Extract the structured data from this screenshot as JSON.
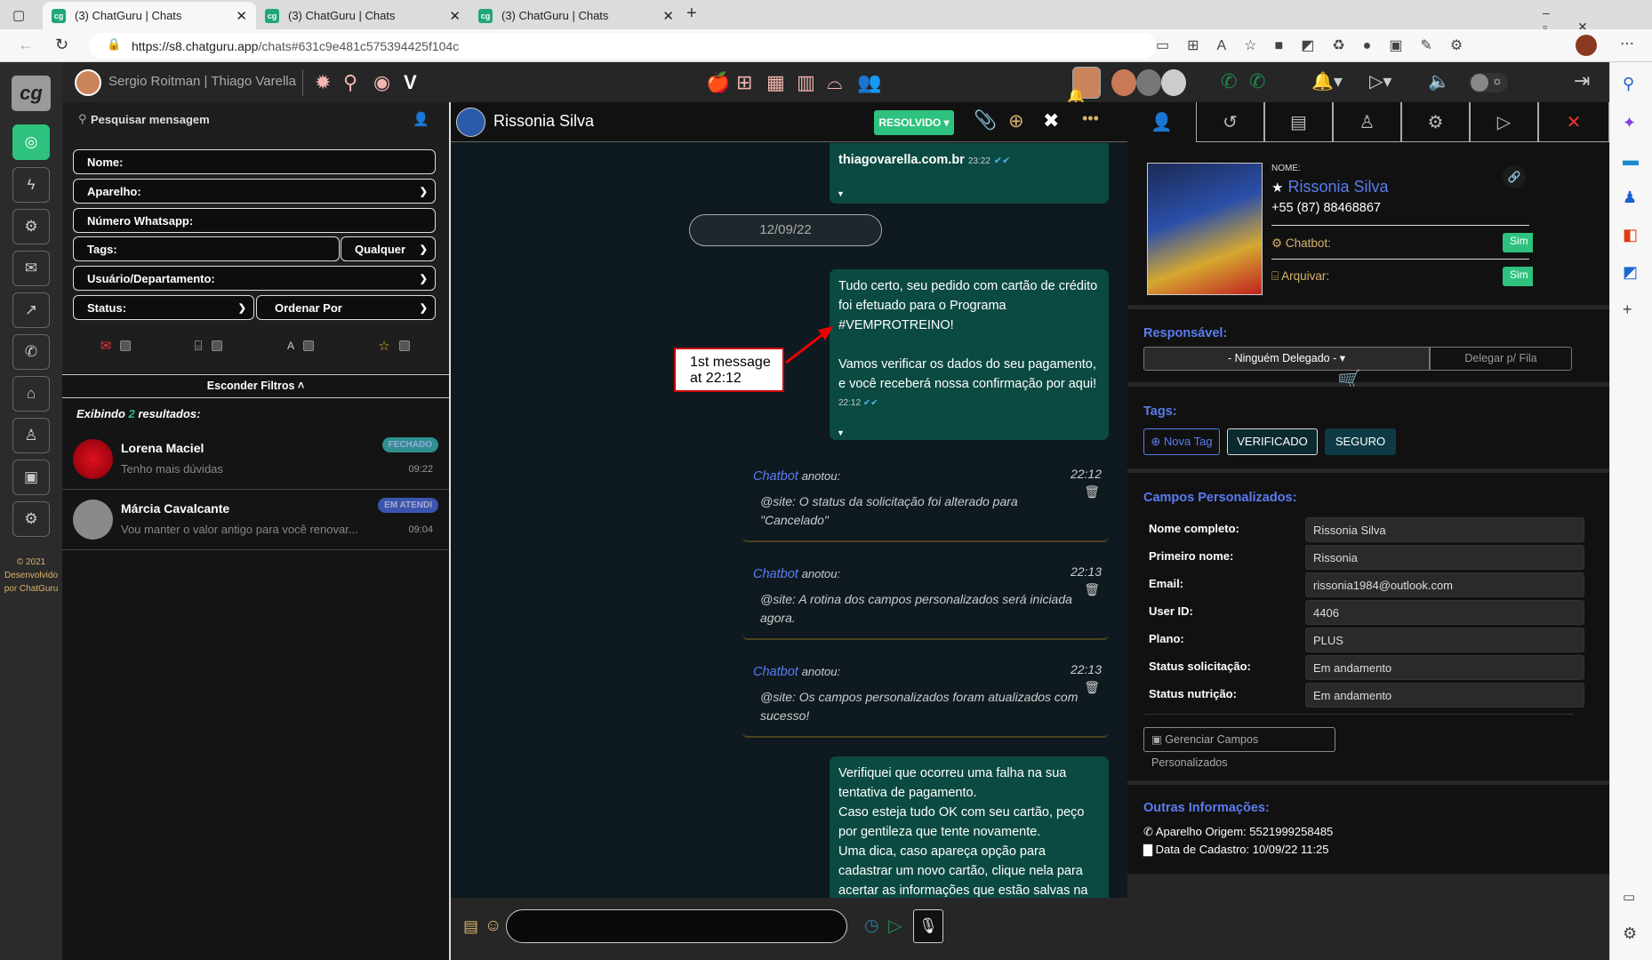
{
  "browser": {
    "tabs": [
      {
        "title": "(3) ChatGuru | Chats"
      },
      {
        "title": "(3) ChatGuru | Chats"
      },
      {
        "title": "(3) ChatGuru | Chats"
      }
    ],
    "url_host": "https://s8.chatguru.app",
    "url_path": "/chats#631c9e481c575394425f104c",
    "favicon": "cg"
  },
  "app": {
    "logo": "cg",
    "user": "Sergio Roitman | Thiago Varella",
    "footer": "© 2021 Desenvolvido por ChatGuru"
  },
  "left": {
    "search_placeholder": "Pesquisar mensagem",
    "filters": {
      "nome": "Nome:",
      "aparelho": "Aparelho:",
      "numero": "Número Whatsapp:",
      "tags": "Tags:",
      "tags_mode": "Qualquer",
      "usuario": "Usuário/Departamento:",
      "status": "Status:",
      "ordenar": "Ordenar Por"
    },
    "hide_filters": "Esconder Filtros",
    "results_prefix": "Exibindo",
    "results_count": "2",
    "results_suffix": "resultados:",
    "chats": [
      {
        "name": "Lorena Maciel",
        "preview": "Tenho mais dúvidas",
        "time": "09:22",
        "badge": "FECHADO",
        "badge_color": "#2f8f8f"
      },
      {
        "name": "Márcia Cavalcante",
        "preview": "Vou manter o valor antigo para você renovar...",
        "time": "09:04",
        "badge": "EM ATENDI",
        "badge_color": "#3a55b0"
      }
    ]
  },
  "chat": {
    "contact": "Rissonia Silva",
    "status_button": "RESOLVIDO",
    "prev_msg_text": "thiagovarella.com.br",
    "prev_msg_time": "23:22",
    "date_divider": "12/09/22",
    "msg1": {
      "lines": [
        "Tudo certo, seu pedido com cartão de crédito foi efetuado para o Programa #VEMPROTREINO!",
        "Vamos verificar os dados do seu pagamento, e você receberá nossa confirmação por aqui!"
      ],
      "time": "22:12"
    },
    "annotation": "1st message at 22:12",
    "notes": [
      {
        "author": "Chatbot",
        "verb": "anotou:",
        "time": "22:12",
        "text": "@site: O status da solicitação foi alterado para \"Cancelado\""
      },
      {
        "author": "Chatbot",
        "verb": "anotou:",
        "time": "22:13",
        "text": "@site: A rotina dos campos personalizados será iniciada agora."
      },
      {
        "author": "Chatbot",
        "verb": "anotou:",
        "time": "22:13",
        "text": "@site: Os campos personalizados foram atualizados com sucesso!"
      }
    ],
    "msg2": "Verifiquei que ocorreu uma falha na sua tentativa de pagamento.\nCaso esteja tudo OK com seu cartão, peço por gentileza que tente novamente.\nUma dica, caso apareça opção para cadastrar um novo cartão, clique nela para acertar as informações que estão salvas na memória do"
  },
  "contact": {
    "name_label": "NOME:",
    "name": "Rissonia Silva",
    "phone": "+55 (87) 88468867",
    "chatbot_label": "Chatbot:",
    "chatbot_value": "Sim",
    "arquivar_label": "Arquivar:",
    "arquivar_value": "Sim",
    "responsavel_label": "Responsável:",
    "responsavel_value": "- Ninguém Delegado -",
    "delegar": "Delegar p/ Fila",
    "tags_label": "Tags:",
    "nova_tag": "Nova Tag",
    "tags": [
      "VERIFICADO",
      "SEGURO"
    ],
    "campos_label": "Campos Personalizados:",
    "campos": [
      {
        "label": "Nome completo:",
        "value": "Rissonia Silva"
      },
      {
        "label": "Primeiro nome:",
        "value": "Rissonia"
      },
      {
        "label": "Email:",
        "value": "rissonia1984@outlook.com"
      },
      {
        "label": "User ID:",
        "value": "4406"
      },
      {
        "label": "Plano:",
        "value": "PLUS"
      },
      {
        "label": "Status solicitação:",
        "value": "Em andamento"
      },
      {
        "label": "Status nutrição:",
        "value": "Em andamento"
      }
    ],
    "gerenciar": "Gerenciar Campos Personalizados",
    "outras_label": "Outras Informações:",
    "aparelho": "Aparelho Origem: 5521999258485",
    "cadastro": "Data de Cadastro: 10/09/22 11:25"
  },
  "colors": {
    "accent_green": "#2ec27e",
    "link_blue": "#5a7cf0",
    "bubble": "#0b4a42"
  }
}
